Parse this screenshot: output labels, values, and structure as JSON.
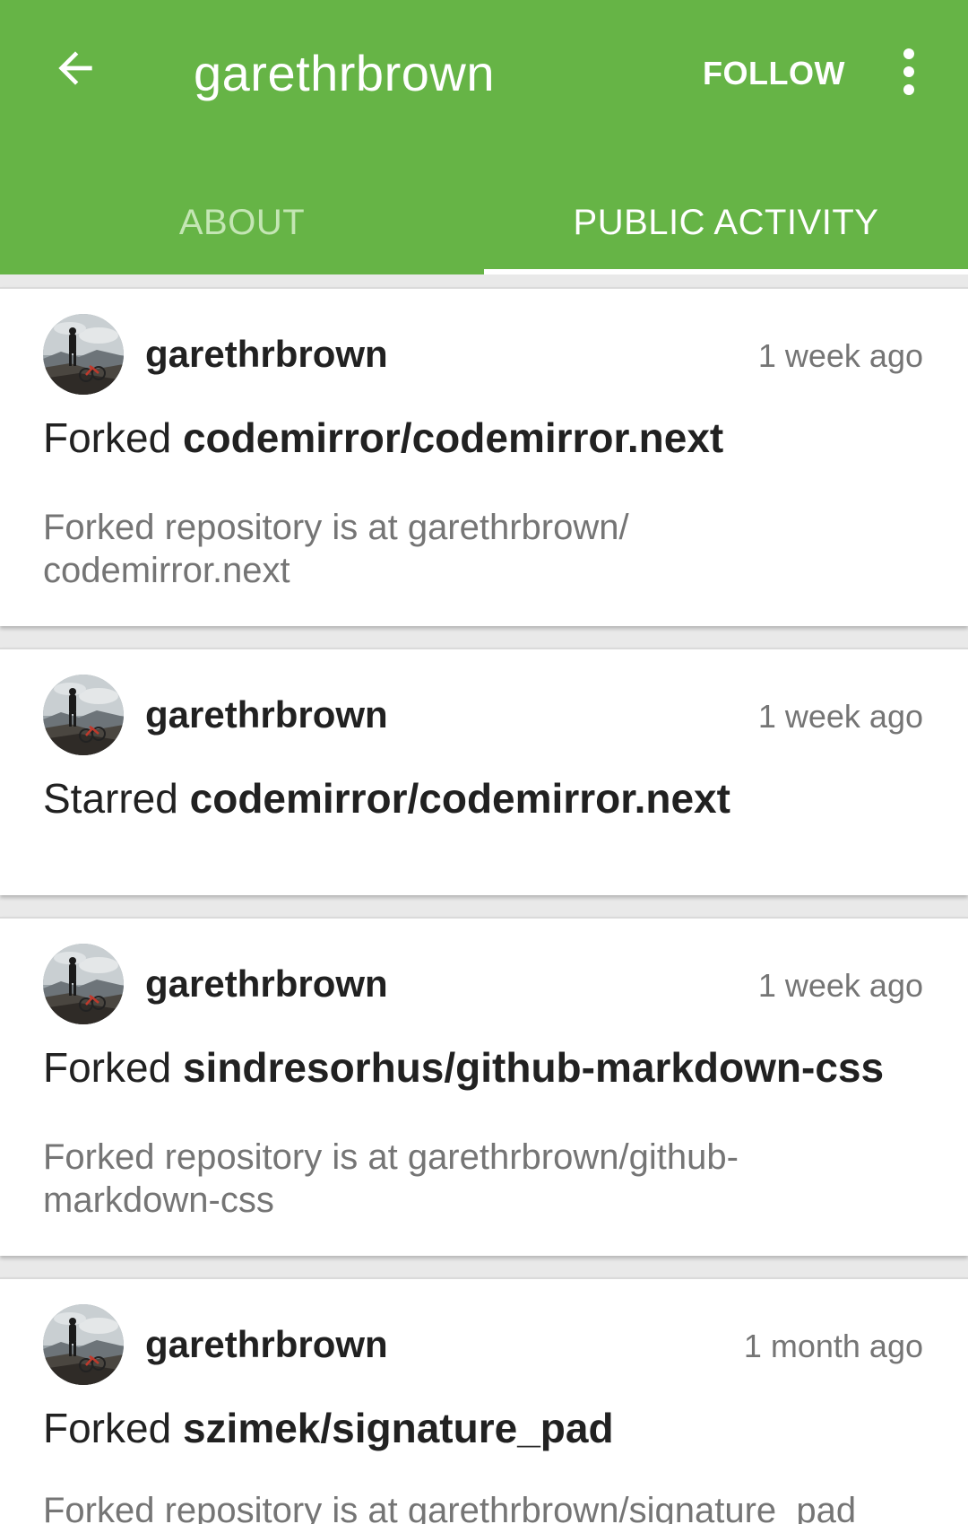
{
  "appbar": {
    "title": "garethrbrown",
    "follow_label": "FOLLOW",
    "background_color": "#66b446",
    "back_icon": "arrow-left-icon",
    "overflow_icon": "more-vertical-icon"
  },
  "tabs": [
    {
      "label": "ABOUT",
      "active": false
    },
    {
      "label": "PUBLIC ACTIVITY",
      "active": true
    }
  ],
  "feed": [
    {
      "user": "garethrbrown",
      "time": "1 week ago",
      "verb": "Forked",
      "repo": "codemirror/codemirror.next",
      "description_line1": "Forked repository is at garethrbrown/",
      "description_line2": "codemirror.next"
    },
    {
      "user": "garethrbrown",
      "time": "1 week ago",
      "verb": "Starred",
      "repo": "codemirror/codemirror.next"
    },
    {
      "user": "garethrbrown",
      "time": "1 week ago",
      "verb": "Forked",
      "repo": "sindresorhus/github-markdown-css",
      "description_line1": "Forked repository is at garethrbrown/github-",
      "description_line2": "markdown-css"
    },
    {
      "user": "garethrbrown",
      "time": "1 month ago",
      "verb": "Forked",
      "repo": "szimek/signature_pad",
      "description_line1": "Forked repository is at garethrbrown/signature_pad"
    }
  ]
}
